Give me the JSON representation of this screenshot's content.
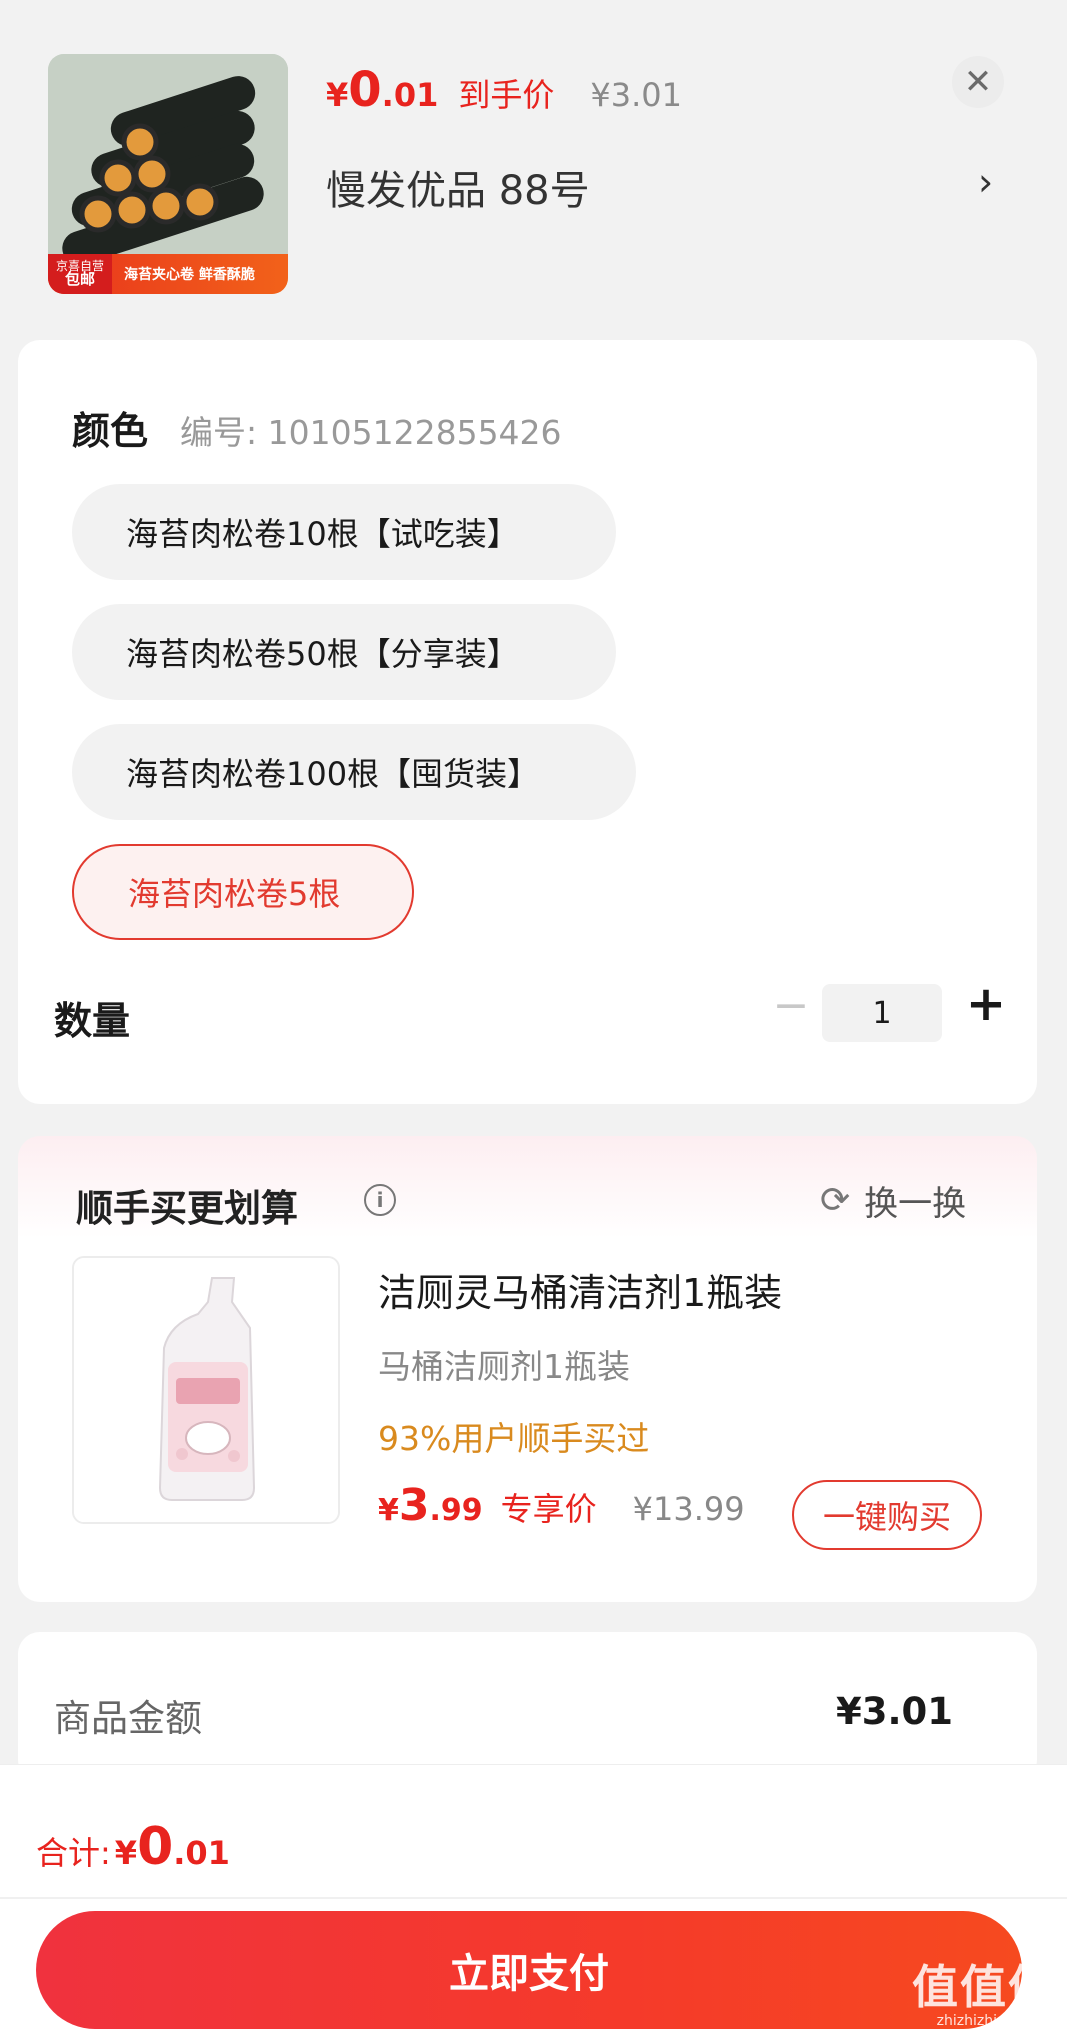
{
  "header": {
    "thumb_tag_top": "京喜自营",
    "thumb_tag_bottom": "包邮",
    "thumb_strip_text": "海苔夹心卷 鲜香酥脆",
    "price_yen": "¥",
    "price_int": "0",
    "price_dec": ".01",
    "price_label": "到手价",
    "original_price": "¥3.01",
    "shop_name": "慢发优品  88号",
    "close_glyph": "✕",
    "chevron_glyph": "›"
  },
  "spec": {
    "title": "颜色",
    "code": "编号: 10105122855426",
    "options": [
      "海苔肉松卷10根【试吃装】",
      "海苔肉松卷50根【分享装】",
      "海苔肉松卷100根【囤货装】",
      "海苔肉松卷5根"
    ],
    "selected_index": 3,
    "quantity_label": "数量",
    "minus_glyph": "−",
    "plus_glyph": "+",
    "quantity": "1"
  },
  "upsell": {
    "title": "顺手买更划算",
    "info_glyph": "i",
    "swap_label": "换一换",
    "refresh_glyph": "⟳",
    "product_name": "洁厕灵马桶清洁剂1瓶装",
    "product_sub": "马桶洁厕剂1瓶装",
    "stat": "93%用户顺手买过",
    "price_yen": "¥",
    "price_int": "3",
    "price_dec": ".99",
    "price_label": "专享价",
    "original_price": "¥13.99",
    "buy_label": "一键购买"
  },
  "amount": {
    "label": "商品金额",
    "value": "¥3.01"
  },
  "footer": {
    "total_label": "合计:",
    "total_yen": "¥",
    "total_int": "0",
    "total_dec": ".01",
    "pay_label": "立即支付",
    "watermark_main": "值值值",
    "watermark_sub": "zhizhizhi.com"
  },
  "colors": {
    "accent_red": "#e8231e",
    "stat_orange": "#d98a1e"
  }
}
